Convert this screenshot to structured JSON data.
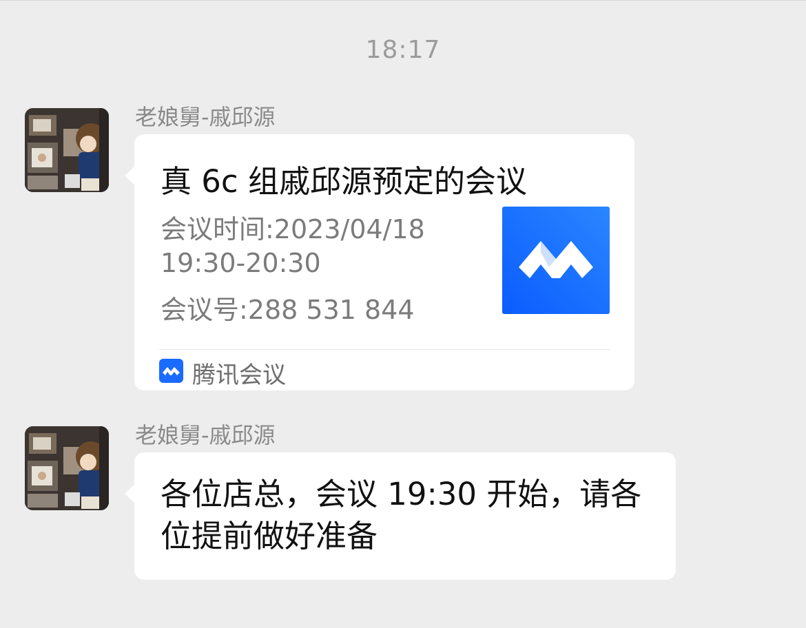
{
  "chat": {
    "timestamp": "18:17",
    "messages": [
      {
        "sender": "老娘舅-戚邱源",
        "avatar_icon": "cartoon-avatar-icon",
        "type": "meeting-card",
        "card": {
          "title": "真 6c 组戚邱源预定的会议",
          "time_line": "会议时间:2023/04/18",
          "time_range": "19:30-20:30",
          "meeting_id_line": "会议号:288 531 844",
          "logo_icon": "tencent-meeting-logo-icon",
          "app_name": "腾讯会议",
          "app_icon": "tencent-meeting-small-icon"
        }
      },
      {
        "sender": "老娘舅-戚邱源",
        "avatar_icon": "cartoon-avatar-icon",
        "type": "text",
        "text": "各位店总，会议 19:30 开始，请各位提前做好准备"
      }
    ]
  },
  "colors": {
    "background": "#ededed",
    "bubble": "#ffffff",
    "tencent_meeting_blue": "#1a6bff"
  }
}
